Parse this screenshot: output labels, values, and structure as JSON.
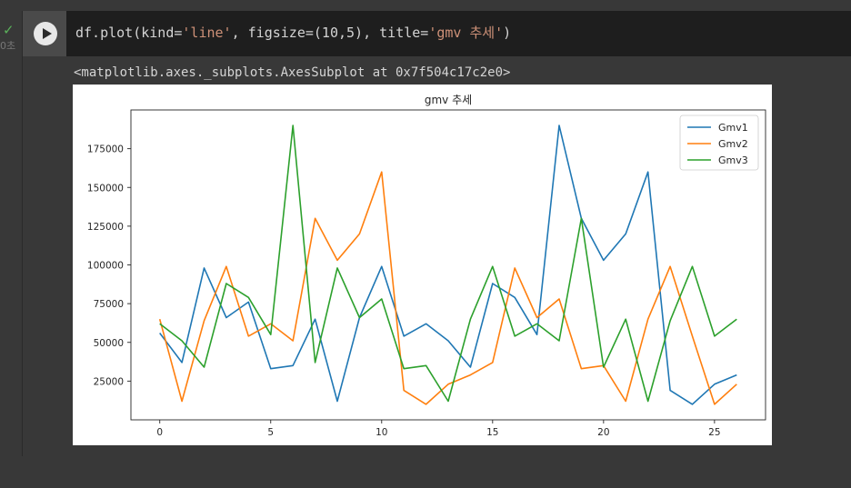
{
  "gutter": {
    "status_icon": "check-icon",
    "exec_time": "0초"
  },
  "cell": {
    "code": {
      "prefix": "df.plot(kind=",
      "kind_str": "'line'",
      "mid": ", figsize=(10,5), title=",
      "title_str": "'gmv 추세'",
      "suffix": ")"
    },
    "output_repr": "<matplotlib.axes._subplots.AxesSubplot at 0x7f504c17c2e0>"
  },
  "chart_data": {
    "type": "line",
    "title": "gmv 추세",
    "xlabel": "",
    "ylabel": "",
    "x": [
      0,
      1,
      2,
      3,
      4,
      5,
      6,
      7,
      8,
      9,
      10,
      11,
      12,
      13,
      14,
      15,
      16,
      17,
      18,
      19,
      20,
      21,
      22,
      23,
      24,
      25,
      26
    ],
    "xlim": [
      -1.3,
      27.3
    ],
    "ylim": [
      0,
      200000
    ],
    "xticks": [
      0,
      5,
      10,
      15,
      20,
      25
    ],
    "yticks": [
      25000,
      50000,
      75000,
      100000,
      125000,
      150000,
      175000
    ],
    "grid": false,
    "legend_position": "top-right",
    "series": [
      {
        "name": "Gmv1",
        "color": "#1f77b4",
        "values": [
          56000,
          37000,
          98000,
          66000,
          76000,
          33000,
          35000,
          65000,
          12000,
          66000,
          99000,
          54000,
          62000,
          51000,
          34000,
          88000,
          79000,
          55000,
          190000,
          130000,
          103000,
          120000,
          160000,
          19000,
          10000,
          23000,
          29000
        ]
      },
      {
        "name": "Gmv2",
        "color": "#ff7f0e",
        "values": [
          65000,
          12000,
          64000,
          99000,
          54000,
          62000,
          51000,
          130000,
          103000,
          120000,
          160000,
          19000,
          10000,
          23000,
          29000,
          37000,
          98000,
          66000,
          78000,
          33000,
          35000,
          12000,
          65000,
          99000,
          54000,
          10000,
          23000
        ]
      },
      {
        "name": "Gmv3",
        "color": "#2ca02c",
        "values": [
          62000,
          51000,
          34000,
          88000,
          79000,
          55000,
          190000,
          37000,
          98000,
          66000,
          78000,
          33000,
          35000,
          12000,
          65000,
          99000,
          54000,
          62000,
          51000,
          130000,
          34000,
          65000,
          12000,
          64000,
          99000,
          54000,
          65000
        ]
      }
    ]
  }
}
